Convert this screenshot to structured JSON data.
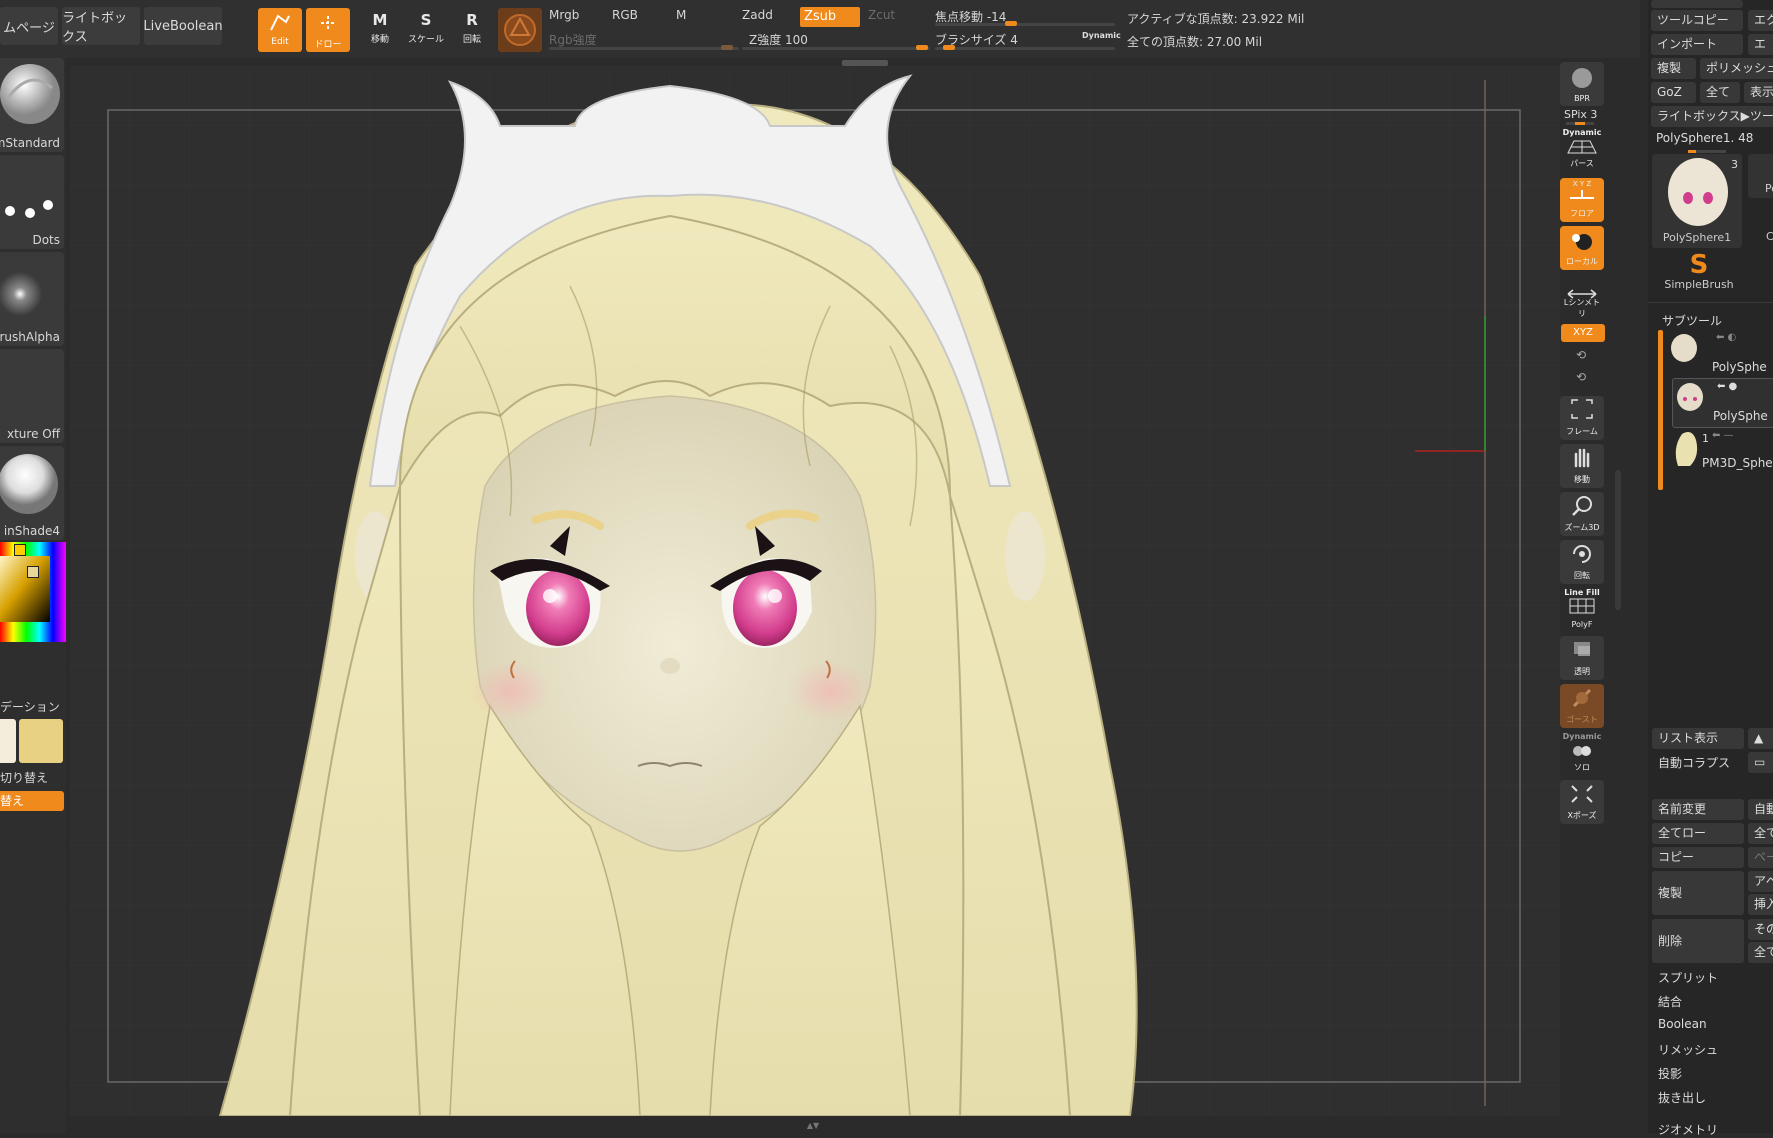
{
  "toolbar": {
    "home_page": "ムページ",
    "lightbox": "ライトボックス",
    "live_boolean": "LiveBoolean",
    "edit": "Edit",
    "draw": "ドロー",
    "move": "移動",
    "scale": "スケール",
    "rotate": "回転",
    "mrgb": "Mrgb",
    "rgb": "RGB",
    "m": "M",
    "rgb_intensity": "Rgb強度",
    "zadd": "Zadd",
    "zsub": "Zsub",
    "zcut": "Zcut",
    "z_intensity": "Z強度 100",
    "focal_shift": "焦点移動 -14",
    "brush_size": "ブラシサイズ 4",
    "dynamic": "Dynamic",
    "active_points": "アクティブな頂点数: 23.922 Mil",
    "total_points": "全ての頂点数: 27.00 Mil"
  },
  "left_shelf": {
    "brush": "mStandard",
    "stroke": "Dots",
    "alpha": "rushAlpha",
    "texture": "xture Off",
    "material": "inShade4",
    "gradient": "デーション",
    "switch_color": "切り替え",
    "alternate": "替え"
  },
  "right_shelf": {
    "bpr": "BPR",
    "spix": "SPix 3",
    "dynamic_persp": "Dynamic",
    "persp": "パース",
    "xyz_top": "X Y Z",
    "floor": "フロア",
    "local": "ローカル",
    "symmetry": "Lシンメトリ",
    "xyz": "XYZ",
    "frame": "フレーム",
    "move": "移動",
    "zoom3d": "ズーム3D",
    "rotate": "回転",
    "line_fill": "Line Fill",
    "polyf": "PolyF",
    "transp": "透明",
    "ghost": "ゴースト",
    "dynamic_solo": "Dynamic",
    "solo": "ソロ",
    "xpose": "Xポーズ"
  },
  "tool_panel": {
    "tool_copy": "ツールコピー",
    "ex": "エク",
    "import": "インポート",
    "e": "エ",
    "duplicate": "複製",
    "polymesh": "ポリメッシュ",
    "goz": "GoZ",
    "all": "全て",
    "show": "表示",
    "lightbox_tool": "ライトボックス▶ツー",
    "tool_name": "PolySphere1. 48",
    "thumb_count": "3",
    "thumb_label": "PolySphere1",
    "thumb2": "Po",
    "brush_label": "SimpleBrush",
    "c": "C",
    "subtool": "サブツール",
    "sub1": "PolySphe",
    "sub2": "PolySphe",
    "sub3_num": "1",
    "sub3": "PM3D_Sphe",
    "list_view": "リスト表示",
    "auto_collapse": "自動コラプス",
    "rename": "名前変更",
    "auto": "自動",
    "all_low": "全てロー",
    "all2": "全て",
    "copy": "コピー",
    "paste": "ペー",
    "duplicate2": "複製",
    "append": "アペ",
    "insert": "挿入",
    "delete": "削除",
    "other": "その",
    "all3": "全て",
    "split": "スプリット",
    "merge": "結合",
    "boolean": "Boolean",
    "remesh": "リメッシュ",
    "project": "投影",
    "extract": "抜き出し",
    "geometry": "ジオメトリ"
  },
  "colors": {
    "accent": "#f08a1c",
    "hair": "#ece4b4",
    "skin": "#ebe6cf",
    "headband": "#f2f2f2",
    "eye": "#d23c8c",
    "secondary_color": "#e9d183"
  }
}
